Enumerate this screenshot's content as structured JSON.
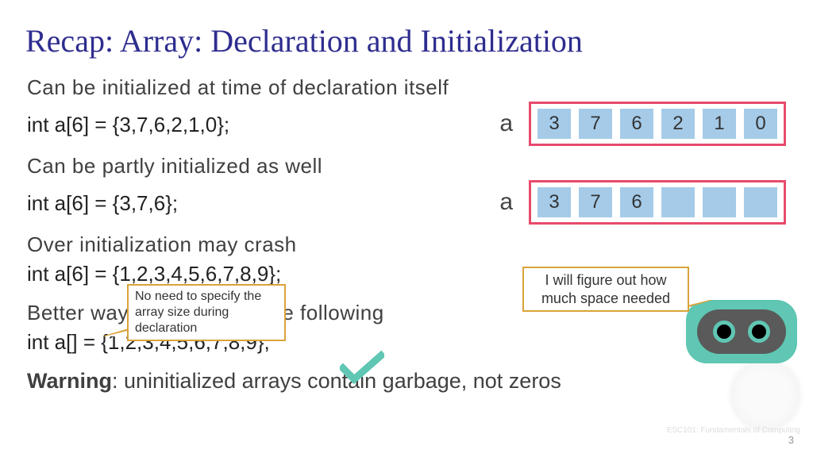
{
  "title": "Recap: Array: Declaration and Initialization",
  "s1": {
    "text": "Can be initialized at time of declaration itself",
    "code": "int a[6] = {3,7,6,2,1,0};",
    "label": "a",
    "cells": [
      "3",
      "7",
      "6",
      "2",
      "1",
      "0"
    ]
  },
  "s2": {
    "text": "Can be partly initialized as well",
    "code": "int a[6] = {3,7,6};",
    "label": "a",
    "cells": [
      "3",
      "7",
      "6",
      "",
      "",
      ""
    ]
  },
  "s3": {
    "text": "Over initialization may crash",
    "code": "int a[6] = {1,2,3,4,5,6,7,8,9};"
  },
  "s4": {
    "text": "Better way to initialize is the following",
    "code": "int a[] = {1,2,3,4,5,6,7,8,9};"
  },
  "callout1": "No need to specify the array size during declaration",
  "callout2": "I will figure out how much space needed",
  "warning_bold": "Warning",
  "warning_rest": ": uninitialized arrays contain garbage, not zeros",
  "page_number": "3",
  "watermark": "ESC101: Fundamentals\nof Computing"
}
